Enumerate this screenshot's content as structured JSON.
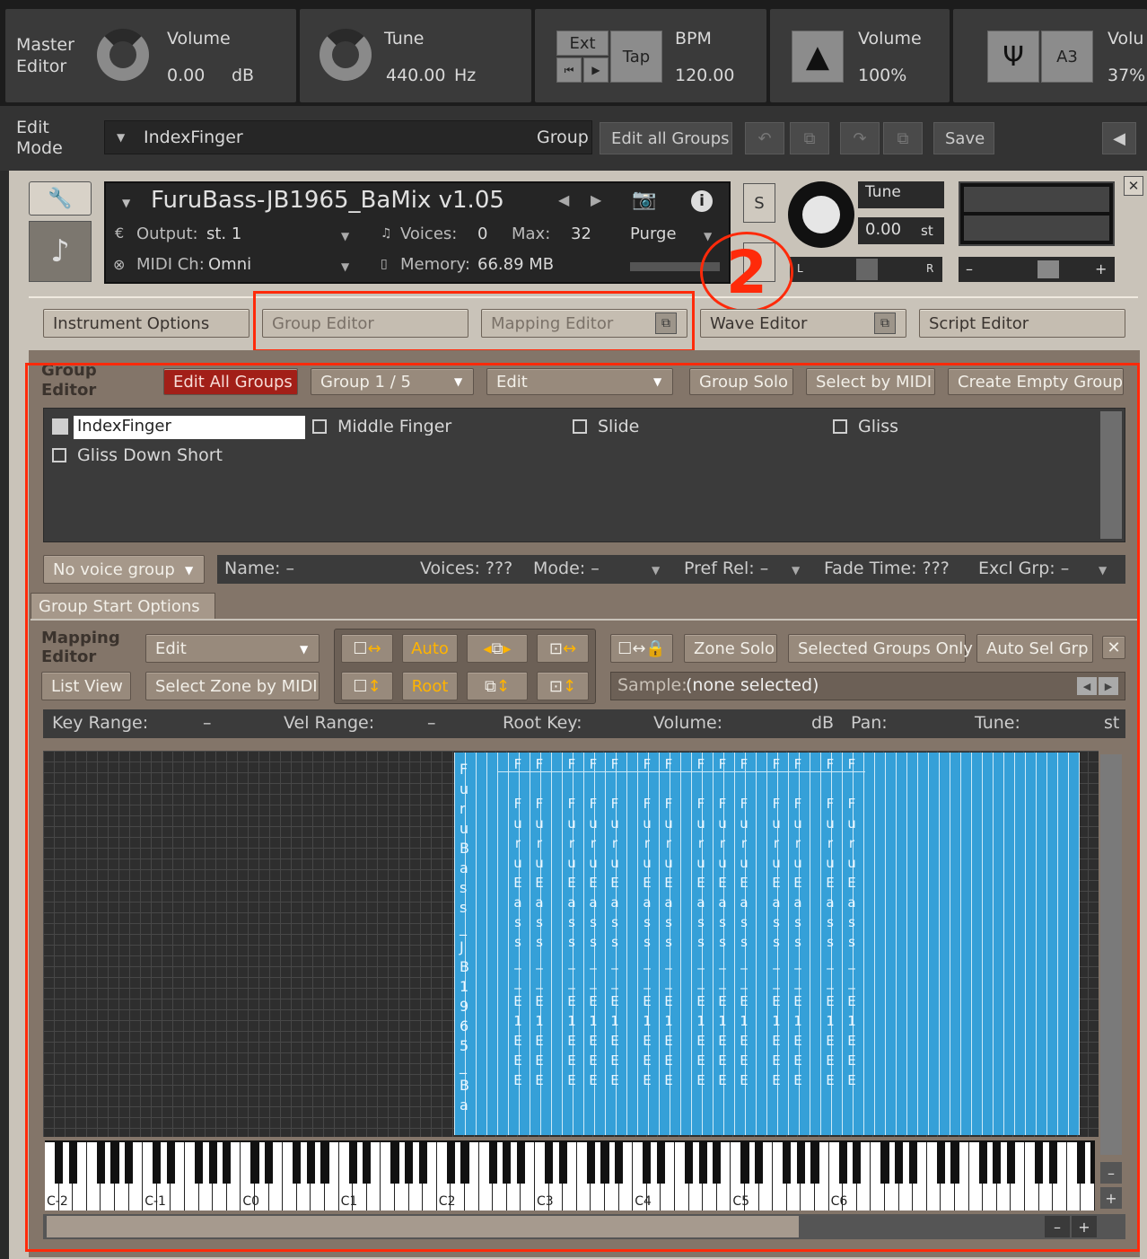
{
  "master": {
    "title": "Master Editor",
    "volume_label": "Volume",
    "volume_value": "0.00",
    "volume_unit": "dB",
    "tune_label": "Tune",
    "tune_value": "440.00",
    "tune_unit": "Hz",
    "ext": "Ext",
    "tap": "Tap",
    "bpm_label": "BPM",
    "bpm_value": "120.00",
    "vol2_label": "Volume",
    "vol2_value": "100%",
    "a3": "A3",
    "vol3_label": "Volu",
    "vol3_value": "37%"
  },
  "editmode": {
    "title": "Edit Mode",
    "group_select": "IndexFinger",
    "group_label": "Group",
    "edit_all": "Edit all Groups",
    "save": "Save"
  },
  "instrument": {
    "name": "FuruBass-JB1965_BaMix v1.05",
    "output_label": "Output:",
    "output_value": "st. 1",
    "voices_label": "Voices:",
    "voices_value": "0",
    "max_label": "Max:",
    "max_value": "32",
    "purge": "Purge",
    "midi_label": "MIDI Ch:",
    "midi_value": "Omni",
    "memory_label": "Memory:",
    "memory_value": "66.89 MB",
    "s": "S",
    "tune_label": "Tune",
    "tune_value": "0.00",
    "tune_unit": "st",
    "l": "L",
    "r": "R",
    "minus": "–",
    "plus": "+",
    "annotation": "2"
  },
  "tabs": [
    "Instrument Options",
    "Group Editor",
    "Mapping Editor",
    "Wave Editor",
    "Script Editor"
  ],
  "group_editor": {
    "title": "Group Editor",
    "edit_all": "Edit All Groups",
    "group_count": "Group 1 / 5",
    "edit": "Edit",
    "group_solo": "Group Solo",
    "select_midi": "Select by MIDI",
    "create_empty": "Create Empty Group",
    "groups": [
      "IndexFinger",
      "Middle Finger",
      "Slide",
      "Gliss",
      "Gliss Down Short"
    ],
    "voice_group": "No voice group",
    "name_label": "Name: –",
    "voices_label": "Voices: ???",
    "mode_label": "Mode: –",
    "pref_label": "Pref Rel: –",
    "fade_label": "Fade Time:  ???",
    "excl_label": "Excl Grp:  –",
    "start_options": "Group Start Options"
  },
  "mapping": {
    "title": "Mapping Editor",
    "edit": "Edit",
    "list_view": "List View",
    "select_zone": "Select Zone by MIDI",
    "auto": "Auto",
    "root": "Root",
    "zone_solo": "Zone Solo",
    "selected_groups": "Selected Groups Only",
    "auto_sel": "Auto Sel Grp",
    "sample_label": "Sample:",
    "sample_value": "(none selected)",
    "key_range": "Key Range:",
    "key_range_v": "–",
    "vel_range": "Vel Range:",
    "vel_range_v": "–",
    "root_key": "Root Key:",
    "volume": "Volume:",
    "volume_u": "dB",
    "pan": "Pan:",
    "tune": "Tune:",
    "tune_u": "st",
    "zone_first": "FuruBass_JB1965_Ba",
    "zone_text": "FuruEass__E1EEE",
    "zone_tops": [
      "F",
      "F",
      "F",
      "F",
      "F",
      "F",
      "F",
      "F",
      "F",
      "F",
      "F",
      "F",
      "F",
      "F",
      "F",
      "F"
    ],
    "octaves": [
      "C-2",
      "C-1",
      "C0",
      "C1",
      "C2",
      "C3",
      "C4",
      "C5",
      "C6"
    ]
  }
}
